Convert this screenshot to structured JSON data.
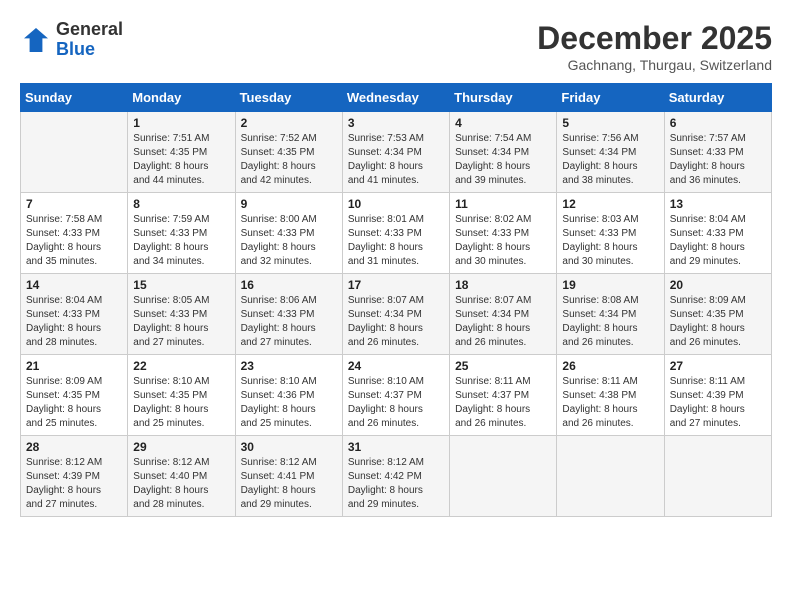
{
  "header": {
    "logo_general": "General",
    "logo_blue": "Blue",
    "month": "December 2025",
    "location": "Gachnang, Thurgau, Switzerland"
  },
  "days_of_week": [
    "Sunday",
    "Monday",
    "Tuesday",
    "Wednesday",
    "Thursday",
    "Friday",
    "Saturday"
  ],
  "weeks": [
    [
      {
        "day": "",
        "info": ""
      },
      {
        "day": "1",
        "info": "Sunrise: 7:51 AM\nSunset: 4:35 PM\nDaylight: 8 hours\nand 44 minutes."
      },
      {
        "day": "2",
        "info": "Sunrise: 7:52 AM\nSunset: 4:35 PM\nDaylight: 8 hours\nand 42 minutes."
      },
      {
        "day": "3",
        "info": "Sunrise: 7:53 AM\nSunset: 4:34 PM\nDaylight: 8 hours\nand 41 minutes."
      },
      {
        "day": "4",
        "info": "Sunrise: 7:54 AM\nSunset: 4:34 PM\nDaylight: 8 hours\nand 39 minutes."
      },
      {
        "day": "5",
        "info": "Sunrise: 7:56 AM\nSunset: 4:34 PM\nDaylight: 8 hours\nand 38 minutes."
      },
      {
        "day": "6",
        "info": "Sunrise: 7:57 AM\nSunset: 4:33 PM\nDaylight: 8 hours\nand 36 minutes."
      }
    ],
    [
      {
        "day": "7",
        "info": "Sunrise: 7:58 AM\nSunset: 4:33 PM\nDaylight: 8 hours\nand 35 minutes."
      },
      {
        "day": "8",
        "info": "Sunrise: 7:59 AM\nSunset: 4:33 PM\nDaylight: 8 hours\nand 34 minutes."
      },
      {
        "day": "9",
        "info": "Sunrise: 8:00 AM\nSunset: 4:33 PM\nDaylight: 8 hours\nand 32 minutes."
      },
      {
        "day": "10",
        "info": "Sunrise: 8:01 AM\nSunset: 4:33 PM\nDaylight: 8 hours\nand 31 minutes."
      },
      {
        "day": "11",
        "info": "Sunrise: 8:02 AM\nSunset: 4:33 PM\nDaylight: 8 hours\nand 30 minutes."
      },
      {
        "day": "12",
        "info": "Sunrise: 8:03 AM\nSunset: 4:33 PM\nDaylight: 8 hours\nand 30 minutes."
      },
      {
        "day": "13",
        "info": "Sunrise: 8:04 AM\nSunset: 4:33 PM\nDaylight: 8 hours\nand 29 minutes."
      }
    ],
    [
      {
        "day": "14",
        "info": "Sunrise: 8:04 AM\nSunset: 4:33 PM\nDaylight: 8 hours\nand 28 minutes."
      },
      {
        "day": "15",
        "info": "Sunrise: 8:05 AM\nSunset: 4:33 PM\nDaylight: 8 hours\nand 27 minutes."
      },
      {
        "day": "16",
        "info": "Sunrise: 8:06 AM\nSunset: 4:33 PM\nDaylight: 8 hours\nand 27 minutes."
      },
      {
        "day": "17",
        "info": "Sunrise: 8:07 AM\nSunset: 4:34 PM\nDaylight: 8 hours\nand 26 minutes."
      },
      {
        "day": "18",
        "info": "Sunrise: 8:07 AM\nSunset: 4:34 PM\nDaylight: 8 hours\nand 26 minutes."
      },
      {
        "day": "19",
        "info": "Sunrise: 8:08 AM\nSunset: 4:34 PM\nDaylight: 8 hours\nand 26 minutes."
      },
      {
        "day": "20",
        "info": "Sunrise: 8:09 AM\nSunset: 4:35 PM\nDaylight: 8 hours\nand 26 minutes."
      }
    ],
    [
      {
        "day": "21",
        "info": "Sunrise: 8:09 AM\nSunset: 4:35 PM\nDaylight: 8 hours\nand 25 minutes."
      },
      {
        "day": "22",
        "info": "Sunrise: 8:10 AM\nSunset: 4:35 PM\nDaylight: 8 hours\nand 25 minutes."
      },
      {
        "day": "23",
        "info": "Sunrise: 8:10 AM\nSunset: 4:36 PM\nDaylight: 8 hours\nand 25 minutes."
      },
      {
        "day": "24",
        "info": "Sunrise: 8:10 AM\nSunset: 4:37 PM\nDaylight: 8 hours\nand 26 minutes."
      },
      {
        "day": "25",
        "info": "Sunrise: 8:11 AM\nSunset: 4:37 PM\nDaylight: 8 hours\nand 26 minutes."
      },
      {
        "day": "26",
        "info": "Sunrise: 8:11 AM\nSunset: 4:38 PM\nDaylight: 8 hours\nand 26 minutes."
      },
      {
        "day": "27",
        "info": "Sunrise: 8:11 AM\nSunset: 4:39 PM\nDaylight: 8 hours\nand 27 minutes."
      }
    ],
    [
      {
        "day": "28",
        "info": "Sunrise: 8:12 AM\nSunset: 4:39 PM\nDaylight: 8 hours\nand 27 minutes."
      },
      {
        "day": "29",
        "info": "Sunrise: 8:12 AM\nSunset: 4:40 PM\nDaylight: 8 hours\nand 28 minutes."
      },
      {
        "day": "30",
        "info": "Sunrise: 8:12 AM\nSunset: 4:41 PM\nDaylight: 8 hours\nand 29 minutes."
      },
      {
        "day": "31",
        "info": "Sunrise: 8:12 AM\nSunset: 4:42 PM\nDaylight: 8 hours\nand 29 minutes."
      },
      {
        "day": "",
        "info": ""
      },
      {
        "day": "",
        "info": ""
      },
      {
        "day": "",
        "info": ""
      }
    ]
  ]
}
